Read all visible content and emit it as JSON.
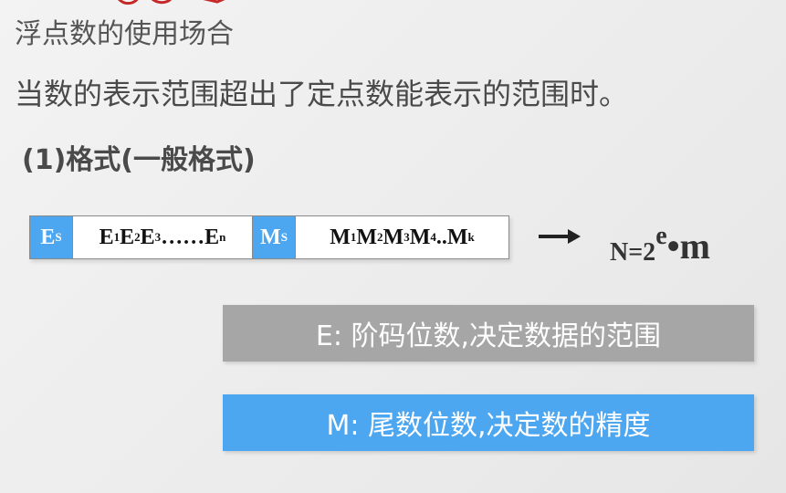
{
  "title": "浮点数的使用场合",
  "subtitle": "当数的表示范围超出了定点数能表示的范围时。",
  "section_heading": "(1)格式(一般格式)",
  "format": {
    "es": "E",
    "es_sub": "S",
    "exp": [
      "E",
      "1",
      "E",
      "2",
      "E",
      "3",
      "……E",
      "n"
    ],
    "ms": "M",
    "ms_sub": "S",
    "man": [
      "M",
      "1",
      "M",
      "2",
      "M",
      "3",
      "M",
      "4",
      "..M",
      "k"
    ]
  },
  "formula": {
    "base": "N=2",
    "exponent": "e",
    "tail": "•m"
  },
  "box_e_label": "E: 阶码位数,决定数据的范围",
  "box_m_label": "M: 尾数位数,决定数的精度",
  "colors": {
    "accent_blue": "#4da6f0",
    "gray_box": "#a6a6a6",
    "scribble_red": "#c62828"
  }
}
